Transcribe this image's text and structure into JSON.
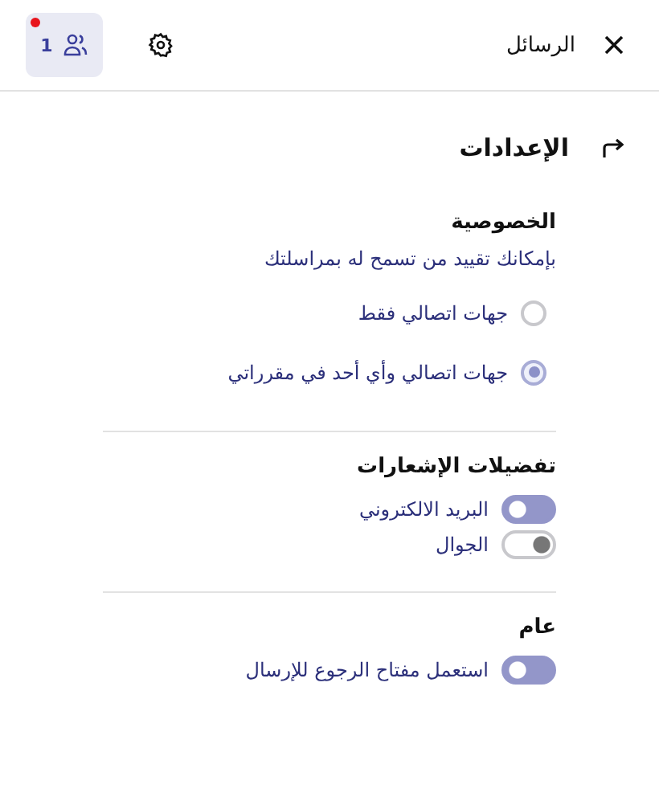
{
  "header": {
    "title": "الرسائل",
    "contacts_count": "1",
    "notification_dot": true
  },
  "page": {
    "title": "الإعدادات"
  },
  "sections": [
    {
      "title": "الخصوصية",
      "description": "بإمكانك تقييد من تسمح له بمراسلتك",
      "items": [
        {
          "kind": "radio",
          "label": "جهات اتصالي فقط",
          "selected": false
        },
        {
          "kind": "radio",
          "label": "جهات اتصالي وأي أحد في مقرراتي",
          "selected": true
        }
      ]
    },
    {
      "title": "تفضيلات الإشعارات",
      "items": [
        {
          "kind": "toggle",
          "label": "البريد الالكتروني",
          "on": true
        },
        {
          "kind": "toggle",
          "label": "الجوال",
          "on": false
        }
      ]
    },
    {
      "title": "عام",
      "items": [
        {
          "kind": "toggle",
          "label": "استعمل مفتاح الرجوع للإرسال",
          "on": true
        }
      ]
    }
  ]
}
